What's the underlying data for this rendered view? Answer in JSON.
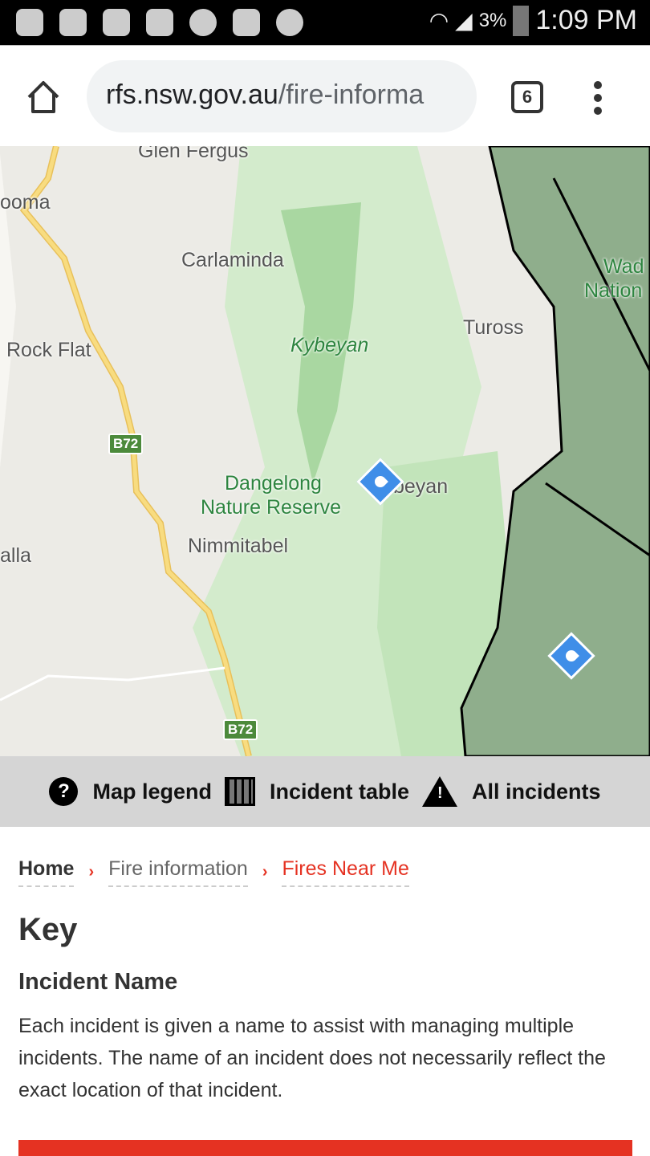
{
  "status_bar": {
    "battery": "3%",
    "time": "1:09 PM",
    "icons": [
      "hangouts-icon",
      "gmail-icon",
      "hangouts-icon",
      "hangouts-icon",
      "music-icon",
      "play-store-icon",
      "headphones-icon",
      "wifi-icon",
      "signal-icon",
      "battery-charging-icon"
    ]
  },
  "browser": {
    "url_host": "rfs.nsw.gov.au",
    "url_path": "/fire-informa",
    "tab_count": "6"
  },
  "map": {
    "labels": {
      "glen_fergus": "Glen Fergus",
      "ooma": "ooma",
      "carlaminda": "Carlaminda",
      "rock_flat": "Rock Flat",
      "kybeyan": "Kybeyan",
      "tuross": "Tuross",
      "wad": "Wad",
      "nation": "Nation",
      "dangelong1": "Dangelong",
      "dangelong2": "Nature Reserve",
      "beyan": "beyan",
      "nimmitabel": "Nimmitabel",
      "alla": "alla"
    },
    "road_shields": [
      "B72",
      "B72"
    ],
    "colors": {
      "land": "#ecebe6",
      "park": "#c8e6c0",
      "forest": "#a8d5a0",
      "burnt": "#8aa888",
      "road": "#f6d36b",
      "fire_marker": "#3f8ee8"
    }
  },
  "toolbar": {
    "map_legend": "Map legend",
    "incident_table": "Incident table",
    "all_incidents": "All incidents"
  },
  "breadcrumb": {
    "home": "Home",
    "fire_information": "Fire information",
    "current": "Fires Near Me"
  },
  "content": {
    "title": "Key",
    "subtitle": "Incident Name",
    "description": "Each incident is given a name to assist with managing multiple incidents. The name of an incident does not necessarily reflect the exact location of that incident."
  },
  "colors": {
    "accent": "#e53222"
  }
}
